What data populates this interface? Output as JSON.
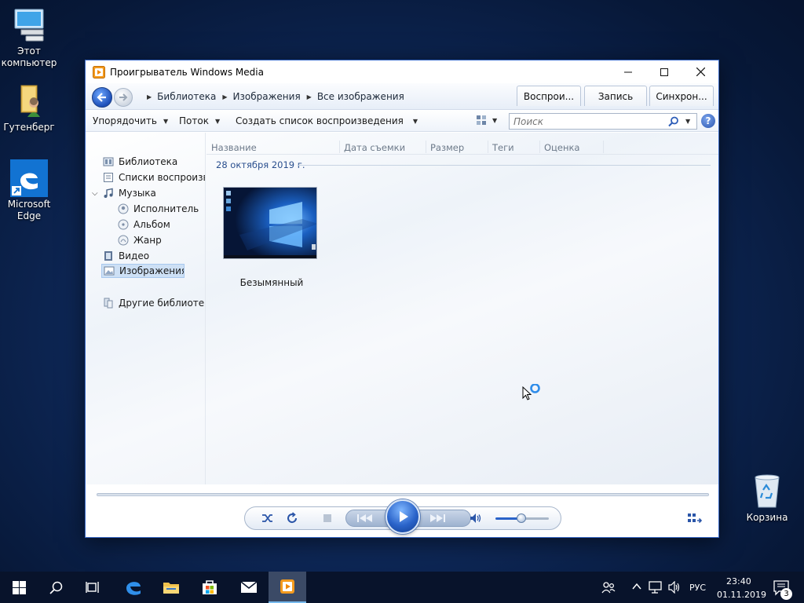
{
  "desktop": {
    "icons": [
      {
        "label": "Этот компьютер"
      },
      {
        "label": "Гутенберг"
      },
      {
        "label": "Microsoft Edge"
      },
      {
        "label": "Корзина"
      }
    ]
  },
  "window": {
    "title": "Проигрыватель Windows Media",
    "breadcrumb": [
      "Библиотека",
      "Изображения",
      "Все изображения"
    ],
    "tabs": [
      {
        "label": "Воспрои..."
      },
      {
        "label": "Запись"
      },
      {
        "label": "Синхрон..."
      }
    ],
    "toolbar": {
      "organize": "Упорядочить",
      "stream": "Поток",
      "create_playlist": "Создать список воспроизведения"
    },
    "search": {
      "placeholder": "Поиск",
      "value": ""
    },
    "help": "?"
  },
  "sidebar": {
    "items": [
      {
        "label": "Библиотека"
      },
      {
        "label": "Списки воспроизведения"
      },
      {
        "label": "Музыка"
      },
      {
        "label": "Исполнитель"
      },
      {
        "label": "Альбом"
      },
      {
        "label": "Жанр"
      },
      {
        "label": "Видео"
      },
      {
        "label": "Изображения"
      },
      {
        "label": "Другие библиотеки"
      }
    ],
    "selected": "Изображения"
  },
  "list": {
    "columns": [
      "Название",
      "Дата съемки",
      "Размер",
      "Теги",
      "Оценка"
    ],
    "group_label": "28 октября 2019 г.",
    "items": [
      {
        "label": "Безымянный"
      }
    ]
  },
  "player": {
    "volume_level": 0.5,
    "seek_position": 0
  },
  "taskbar": {
    "language": "РУС",
    "time": "23:40",
    "date": "01.11.2019",
    "notification_count": "3"
  },
  "colors": {
    "accent": "#2a63c9",
    "desktop_bg": "#0f2a5c",
    "taskbar_bg": "#08132b",
    "selection": "#cde0f5"
  },
  "icons": {
    "back": "arrow-left-icon",
    "forward": "arrow-right-icon",
    "search": "search-icon",
    "help": "help-icon",
    "play": "play-icon"
  }
}
